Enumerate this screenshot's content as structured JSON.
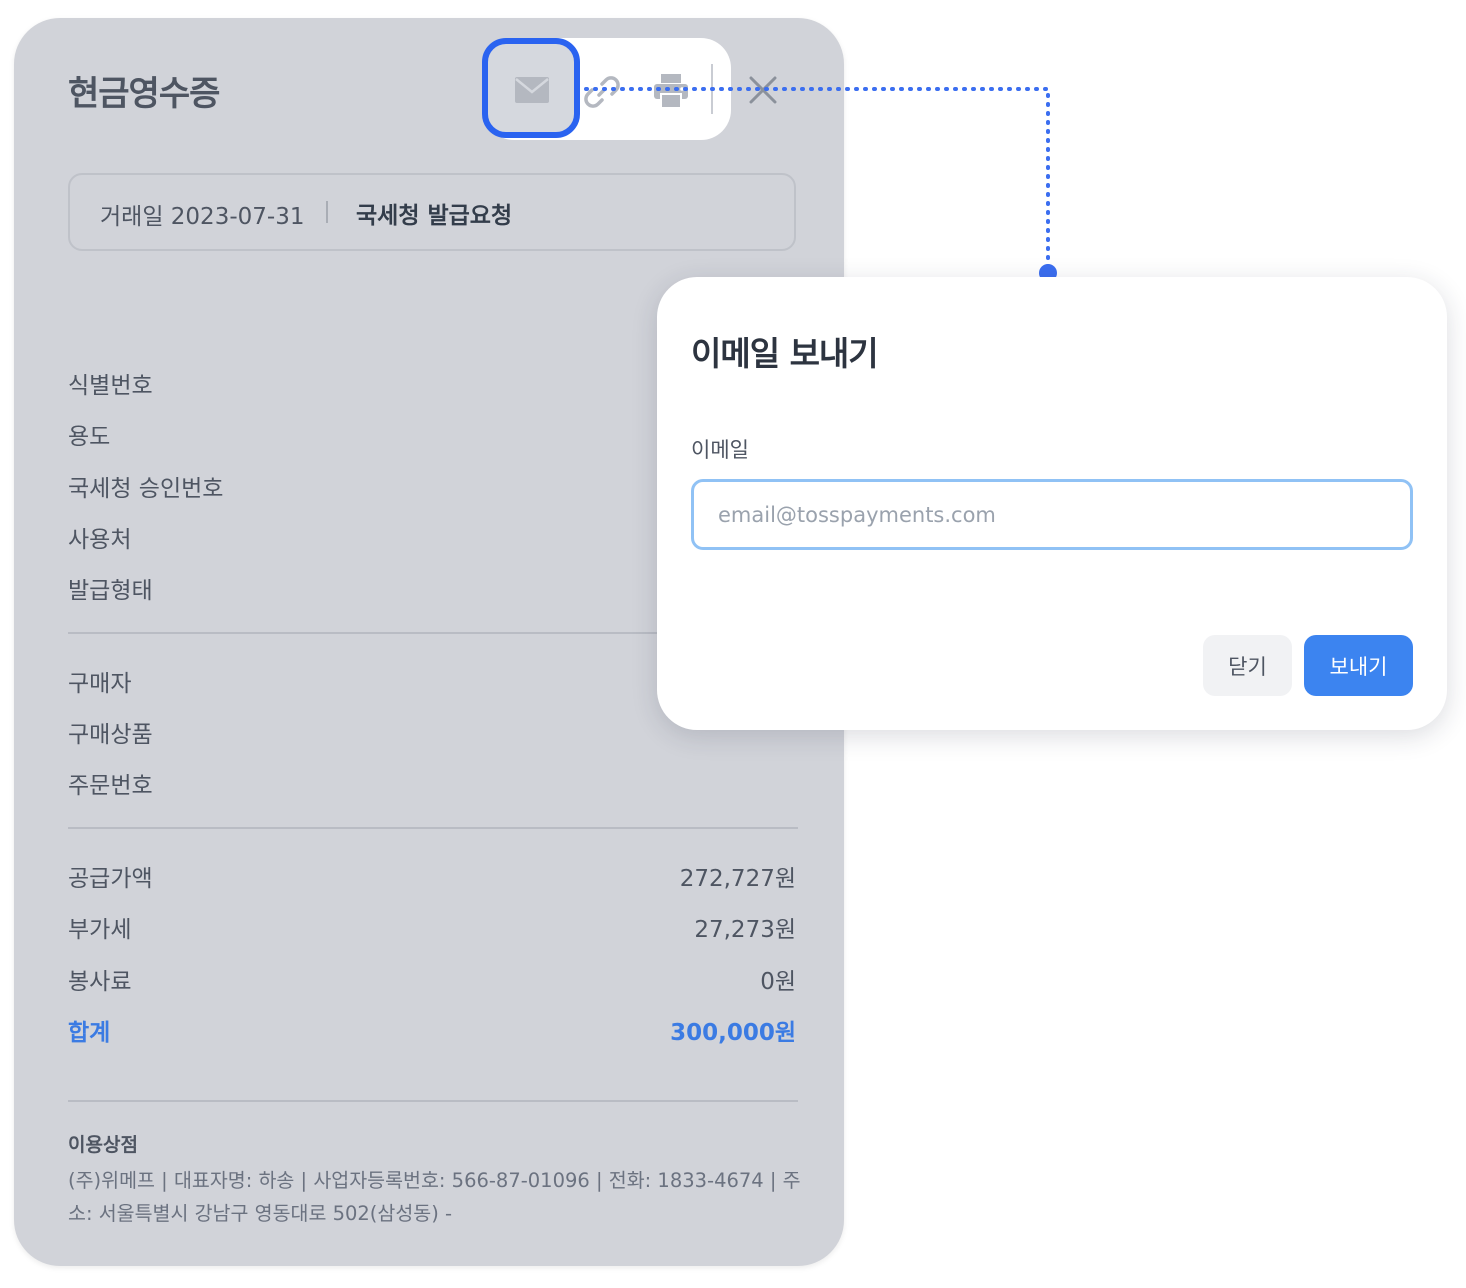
{
  "receipt": {
    "title": "현금영수증",
    "toolbar": {
      "mail_icon": "mail-icon",
      "link_icon": "link-icon",
      "print_icon": "print-icon",
      "close_icon": "close-icon"
    },
    "transaction_date": "거래일 2023-07-31",
    "status": "국세청 발급요청",
    "info_rows": [
      "식별번호",
      "용도",
      "국세청 승인번호",
      "사용처",
      "발급형태"
    ],
    "buyer_rows": [
      "구매자",
      "구매상품",
      "주문번호"
    ],
    "amounts": [
      {
        "label": "공급가액",
        "value": "272,727원"
      },
      {
        "label": "부가세",
        "value": "27,273원"
      },
      {
        "label": "봉사료",
        "value": "0원"
      }
    ],
    "total": {
      "label": "합계",
      "value": "300,000원"
    },
    "merchant_title": "이용상점",
    "merchant_info": "(주)위메프 | 대표자명: 하송 | 사업자등록번호: 566-87-01096 | 전화: 1833-4674 | 주소: 서울특별시 강남구 영동대로 502(삼성동) -"
  },
  "dialog": {
    "title": "이메일 보내기",
    "email_label": "이메일",
    "email_placeholder": "email@tosspayments.com",
    "close_label": "닫기",
    "send_label": "보내기"
  },
  "colors": {
    "highlight": "#2a63f0",
    "connector": "#3b6ef0",
    "total": "#3b7be3",
    "primary_button": "#3c84f0"
  }
}
